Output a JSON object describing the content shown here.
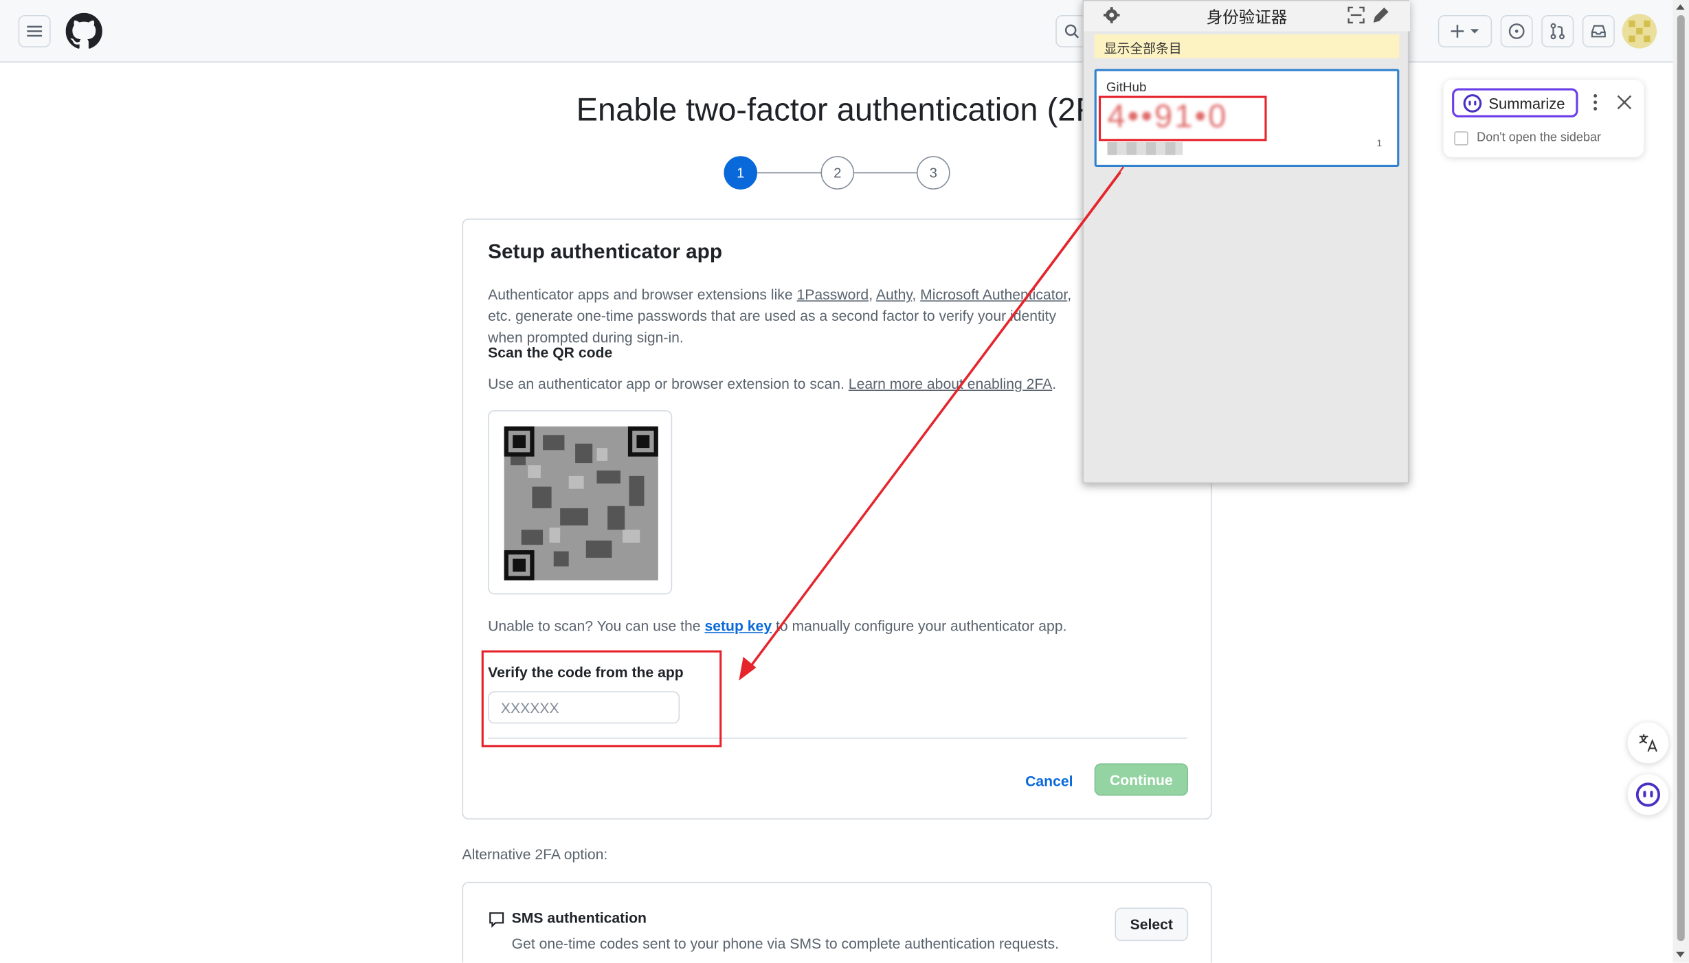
{
  "header": {
    "menu_icon": "hamburger-icon",
    "logo_icon": "github-logo-icon",
    "search_icon": "search-icon",
    "create_icon": "plus-icon",
    "issues_icon": "issue-opened-icon",
    "pulls_icon": "pull-request-icon",
    "inbox_icon": "inbox-icon"
  },
  "page": {
    "title": "Enable two-factor authentication (2FA)",
    "steps": [
      "1",
      "2",
      "3"
    ],
    "active_step": 1
  },
  "setup_card": {
    "title": "Setup authenticator app",
    "desc_prefix": "Authenticator apps and browser extensions like ",
    "apps": [
      "1Password",
      "Authy",
      "Microsoft Authenticator"
    ],
    "sep": ", ",
    "desc_suffix": ", etc. generate one-time passwords that are used as a second factor to verify your identity when prompted during sign-in.",
    "scan_heading": "Scan the QR code",
    "scan_text": "Use an authenticator app or browser extension to scan. ",
    "learn_link": "Learn more about enabling 2FA",
    "period": ".",
    "unable_prefix": "Unable to scan? You can use the ",
    "setup_key_link": "setup key",
    "unable_suffix": " to manually configure your authenticator app.",
    "verify_label": "Verify the code from the app",
    "verify_placeholder": "XXXXXX",
    "verify_value": "",
    "cancel_label": "Cancel",
    "continue_label": "Continue"
  },
  "alternative": {
    "label": "Alternative 2FA option:",
    "sms_title": "SMS authentication",
    "sms_desc": "Get one-time codes sent to your phone via SMS to complete authentication requests.",
    "select_label": "Select"
  },
  "authenticator_popup": {
    "title": "身份验证器",
    "notice": "显示全部条目",
    "issuer": "GitHub",
    "code": "4••91•0",
    "counter": "1"
  },
  "summarize_panel": {
    "button_label": "Summarize",
    "checkbox_label": "Don't open the sidebar",
    "checkbox_checked": false
  },
  "colors": {
    "annotation_red": "#e5242b",
    "primary_blue": "#0969da",
    "continue_disabled_green": "#94d3a2",
    "summarize_purple": "#6a3de8"
  }
}
